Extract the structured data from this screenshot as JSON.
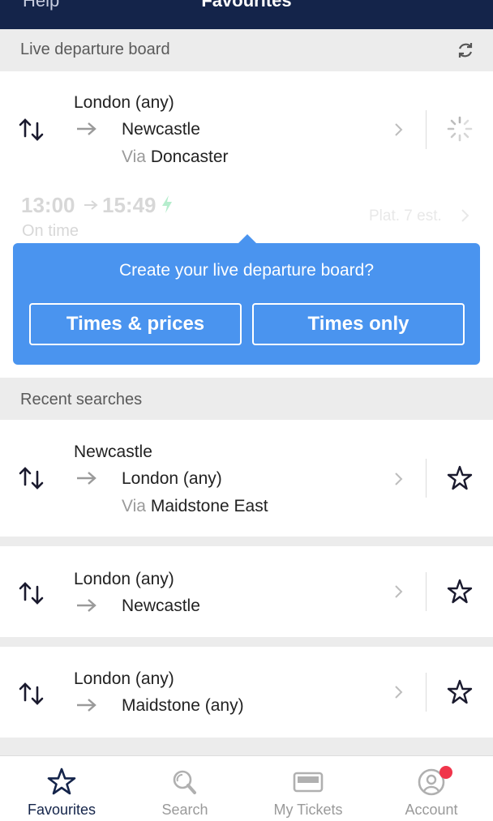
{
  "header": {
    "help_label": "Help",
    "title": "Favourites"
  },
  "live_board": {
    "section_title": "Live departure board",
    "refresh_icon": "refresh-icon",
    "journey": {
      "from": "London (any)",
      "to": "Newcastle",
      "via_word": "Via",
      "via_station": "Doncaster"
    },
    "faded_service": {
      "departure": "13:00",
      "arrival": "15:49",
      "status": "On time",
      "platform": "Plat. 7 est."
    },
    "popup": {
      "question": "Create your live departure board?",
      "button_times_prices": "Times & prices",
      "button_times_only": "Times only"
    }
  },
  "recent": {
    "section_title": "Recent searches",
    "items": [
      {
        "from": "Newcastle",
        "to": "London (any)",
        "via_word": "Via",
        "via_station": "Maidstone East"
      },
      {
        "from": "London (any)",
        "to": "Newcastle"
      },
      {
        "from": "London (any)",
        "to": "Maidstone (any)"
      }
    ]
  },
  "tabbar": {
    "items": [
      {
        "label": "Favourites",
        "icon": "star-icon",
        "active": true
      },
      {
        "label": "Search",
        "icon": "search-icon",
        "active": false
      },
      {
        "label": "My Tickets",
        "icon": "ticket-icon",
        "active": false
      },
      {
        "label": "Account",
        "icon": "account-icon",
        "active": false
      }
    ]
  },
  "colors": {
    "navy": "#14244a",
    "popup_blue": "#4a94ef",
    "badge_red": "#f0354b",
    "bolt_green": "#2ecc71"
  }
}
